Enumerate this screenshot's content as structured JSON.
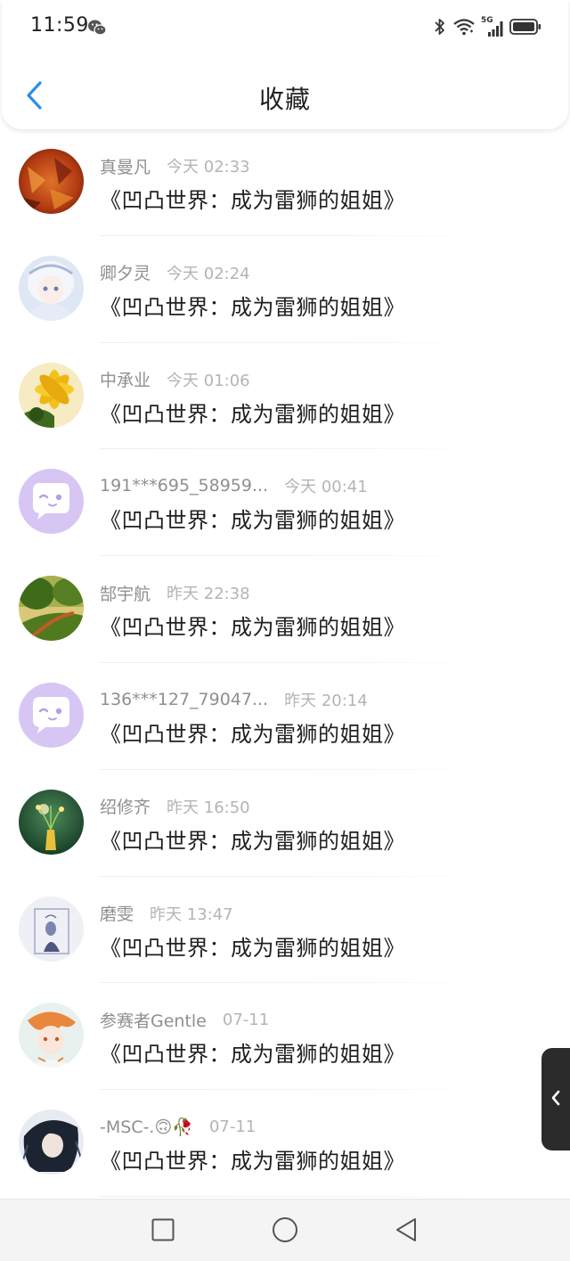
{
  "status_bar": {
    "time": "11:59",
    "icons": [
      "wechat-icon",
      "bluetooth-icon",
      "wifi-icon",
      "signal-5g-icon",
      "battery-icon"
    ],
    "network_label": "5G"
  },
  "header": {
    "title": "收藏",
    "back_icon": "chevron-left-icon"
  },
  "colors": {
    "accent": "#2b8ee6",
    "author_text": "#8f8f8f",
    "time_text": "#b4b4b4",
    "title_text": "#1f1f1f",
    "default_avatar_bg": "#d7c6f3"
  },
  "items": [
    {
      "author": "真曼凡",
      "time": "今天 02:33",
      "title": "《凹凸世界：成为雷狮的姐姐》",
      "avatar": "autumn-leaves"
    },
    {
      "author": "卿夕灵",
      "time": "今天 02:24",
      "title": "《凹凸世界：成为雷狮的姐姐》",
      "avatar": "anime-girl-white"
    },
    {
      "author": "中承业",
      "time": "今天 01:06",
      "title": "《凹凸世界：成为雷狮的姐姐》",
      "avatar": "yellow-flower"
    },
    {
      "author": "191***695_58959...",
      "time": "今天 00:41",
      "title": "《凹凸世界：成为雷狮的姐姐》",
      "avatar": "default-chat"
    },
    {
      "author": "郜宇航",
      "time": "昨天 22:38",
      "title": "《凹凸世界：成为雷狮的姐姐》",
      "avatar": "forest-path"
    },
    {
      "author": "136***127_79047...",
      "time": "昨天 20:14",
      "title": "《凹凸世界：成为雷狮的姐姐》",
      "avatar": "default-chat"
    },
    {
      "author": "绍修齐",
      "time": "昨天 16:50",
      "title": "《凹凸世界：成为雷狮的姐姐》",
      "avatar": "green-vase"
    },
    {
      "author": "磨雯",
      "time": "昨天 13:47",
      "title": "《凹凸世界：成为雷狮的姐姐》",
      "avatar": "sketch-figure"
    },
    {
      "author": "参赛者Gentle",
      "time": "07-11",
      "title": "《凹凸世界：成为雷狮的姐姐》",
      "avatar": "anime-orange-hair"
    },
    {
      "author": "-MSC-.🙃🥀",
      "time": "07-11",
      "title": "《凹凸世界：成为雷狮的姐姐》",
      "avatar": "anime-dark-hair"
    }
  ],
  "side_handle": {
    "icon": "chevron-left-icon"
  },
  "nav_bar": {
    "buttons": [
      "recent-apps-icon",
      "home-icon",
      "back-icon"
    ]
  }
}
